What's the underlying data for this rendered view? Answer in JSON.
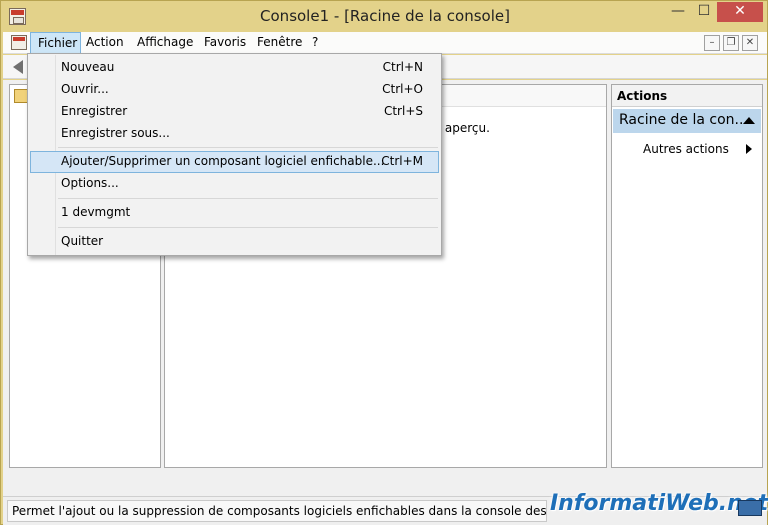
{
  "window": {
    "title": "Console1 - [Racine de la console]"
  },
  "menubar": {
    "items": [
      "Fichier",
      "Action",
      "Affichage",
      "Favoris",
      "Fenêtre",
      "?"
    ]
  },
  "file_menu": {
    "items": [
      {
        "label": "Nouveau",
        "shortcut": "Ctrl+N"
      },
      {
        "label": "Ouvrir...",
        "shortcut": "Ctrl+O"
      },
      {
        "label": "Enregistrer",
        "shortcut": "Ctrl+S"
      },
      {
        "label": "Enregistrer sous...",
        "shortcut": ""
      },
      {
        "label": "Ajouter/Supprimer un composant logiciel enfichable...",
        "shortcut": "Ctrl+M"
      },
      {
        "label": "Options...",
        "shortcut": ""
      },
      {
        "label": "1 devmgmt",
        "shortcut": ""
      },
      {
        "label": "Quitter",
        "shortcut": ""
      }
    ]
  },
  "center": {
    "visible_text": "et aperçu."
  },
  "actions": {
    "title": "Actions",
    "section": "Racine de la con...",
    "item": "Autres actions"
  },
  "status": {
    "text": "Permet l'ajout ou la suppression de composants logiciels enfichables dans la console des composant"
  },
  "watermark": {
    "text": "InformatiWeb.net"
  },
  "colors": {
    "highlight": "#d5e6f6",
    "titlebar": "#e3d28a",
    "close": "#c7504b"
  },
  "icons": [
    "console-icon",
    "back-arrow-icon",
    "folder-icon",
    "collapse-icon",
    "submenu-arrow-icon"
  ]
}
